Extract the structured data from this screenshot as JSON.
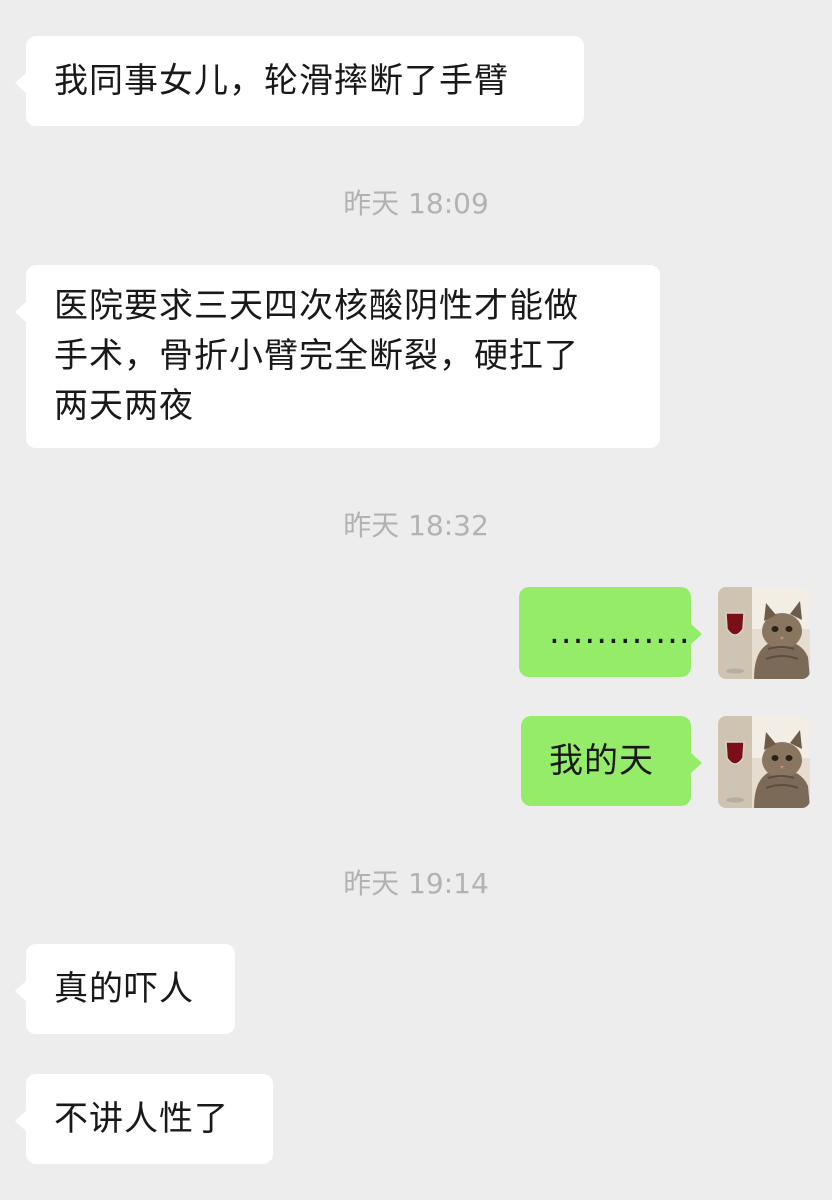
{
  "messages": [
    {
      "text": "我同事女儿，轮滑摔断了手臂"
    },
    {
      "text": "医院要求三天四次核酸阴性才能做\n手术，骨折小臂完全断裂，硬扛了\n两天两夜"
    },
    {
      "text": "............"
    },
    {
      "text": "我的天"
    },
    {
      "text": "真的吓人"
    },
    {
      "text": "不讲人性了"
    }
  ],
  "timestamps": [
    {
      "text": "昨天 18:09"
    },
    {
      "text": "昨天 18:32"
    },
    {
      "text": "昨天 19:14"
    }
  ],
  "colors": {
    "background": "#ededed",
    "incoming_bubble": "#ffffff",
    "outgoing_bubble": "#95ec69",
    "timestamp_text": "#b2b2b2",
    "message_text": "#191919"
  },
  "avatar": {
    "icon": "cat-with-wine-glass-avatar"
  }
}
